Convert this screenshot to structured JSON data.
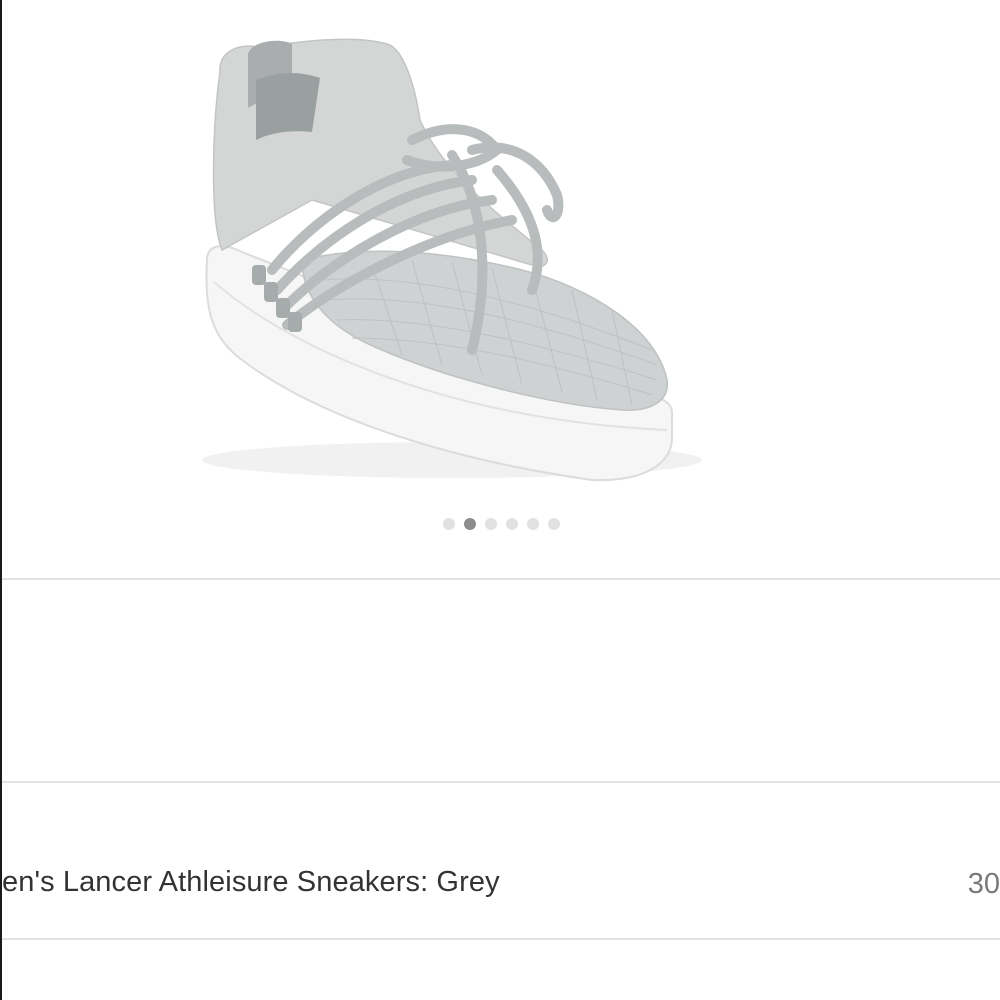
{
  "product": {
    "title": "en's Lancer Athleisure Sneakers: Grey",
    "price": "30",
    "image_icon": "sneaker-image"
  },
  "pager": {
    "count": 6,
    "active_index": 1
  },
  "colors": {
    "divider": "#e3e3e3",
    "dot_inactive": "#e1e1e1",
    "dot_active": "#8c8c8c",
    "shoe_grey": "#c9cccc",
    "sole": "#f4f4f4"
  }
}
